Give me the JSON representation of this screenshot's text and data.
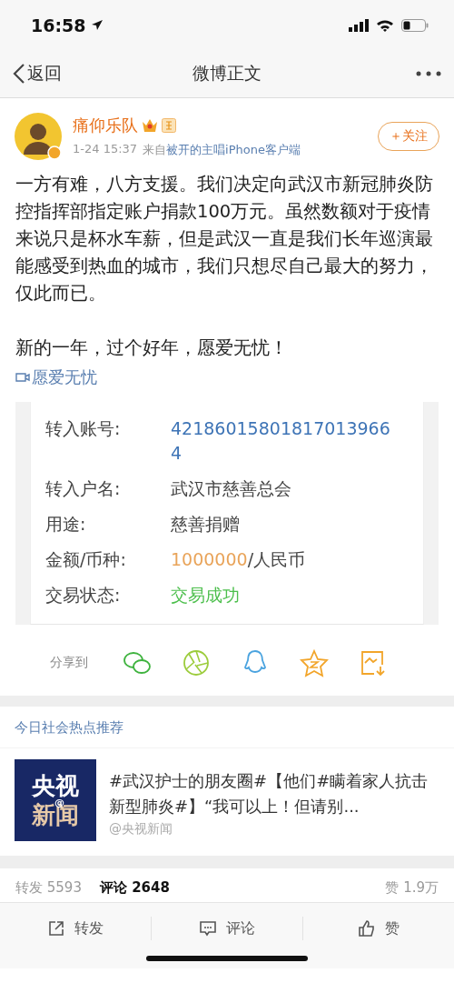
{
  "status_bar": {
    "time": "16:58"
  },
  "nav": {
    "back": "返回",
    "title": "微博正文"
  },
  "author": {
    "name": "痛仰乐队",
    "time": "1-24 15:37",
    "source_prefix": "来自",
    "source": "被开的主唱iPhone客户端",
    "follow": "＋关注"
  },
  "post": {
    "text": "一方有难，八方支援。我们决定向武汉市新冠肺炎防控指挥部指定账户捐款100万元。虽然数额对于疫情来说只是杯水车薪，但是武汉一直是我们长年巡演最能感受到热血的城市，我们只想尽自己最大的努力，仅此而已。",
    "text_2": "新的一年，过个好年，愿爱无忧！",
    "topic": "愿爱无忧"
  },
  "receipt": [
    {
      "label": "转入账号:",
      "value": "421860158018170139664",
      "kind": "account"
    },
    {
      "label": "转入户名:",
      "value": "武汉市慈善总会",
      "kind": "plain"
    },
    {
      "label": "用途:",
      "value": "慈善捐赠",
      "kind": "plain"
    },
    {
      "label": "金额/币种:",
      "value": "1000000",
      "suffix": "/人民币",
      "kind": "amount"
    },
    {
      "label": "交易状态:",
      "value": "交易成功",
      "kind": "success"
    }
  ],
  "share": {
    "label": "分享到"
  },
  "recommend": {
    "title": "今日社会热点推荐",
    "thumb": {
      "line_1": "央视",
      "line_2": "新闻",
      "mark": "@"
    },
    "headline": "#武汉护士的朋友圈#【他们#瞒着家人抗击新型肺炎#】“我可以上！但请别...",
    "source": "@央视新闻"
  },
  "counts": [
    {
      "label": "转发 5593",
      "selected": false
    },
    {
      "label": "评论 2648",
      "selected": true
    },
    {
      "label": "赞 1.9万",
      "selected": false
    }
  ],
  "actions": [
    {
      "label": "转发",
      "kind": "repost"
    },
    {
      "label": "评论",
      "kind": "comment"
    },
    {
      "label": "赞",
      "kind": "like"
    }
  ]
}
